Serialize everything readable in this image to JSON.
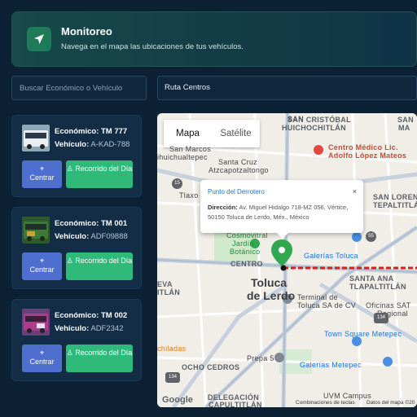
{
  "header": {
    "title": "Monitoreo",
    "subtitle": "Navega en el mapa las ubicaciones de tus vehículos.",
    "icon": "navigation-arrow-icon"
  },
  "search": {
    "placeholder": "Buscar Económico o Vehículo",
    "value": ""
  },
  "route_select": {
    "value": "Ruta Centros"
  },
  "vehicles": [
    {
      "eco_label": "Económico: TM 777",
      "veh_prefix": "Vehículo:",
      "veh_value": "A-KAD-788",
      "center_label": "Centrar",
      "route_label": "Recorrido del Día",
      "thumb_color": "#e8eef2"
    },
    {
      "eco_label": "Económico: TM 001",
      "veh_prefix": "Vehículo:",
      "veh_value": "ADF09888",
      "center_label": "Centrar",
      "route_label": "Recorrido del Día",
      "thumb_color": "#3d7a3a"
    },
    {
      "eco_label": "Económico: TM 002",
      "veh_prefix": "Vehículo:",
      "veh_value": "ADF2342",
      "center_label": "Centrar",
      "route_label": "Recorrido del Día",
      "thumb_color": "#b03a8c"
    }
  ],
  "map": {
    "tabs": [
      "Mapa",
      "Satélite"
    ],
    "active_tab": "Mapa",
    "labels": {
      "san_cristobal": "SAN CRISTÓBAL",
      "huichochitlan": "HUICHOCHITLÁN",
      "san_marcos": "San Marcos",
      "yichualtepec": "ihuichualtepec",
      "santa_cruz": "Santa Cruz",
      "atzcapotzaltongo": "Atzcapotzaltongo",
      "tlaxo": "Tlaxo",
      "san_lorenzo": "SAN LORENZO",
      "tepaltitlan": "TEPALTITLÁN",
      "cosmovitral": "Cosmovitral",
      "jardin": "Jardín",
      "botanico": "Botánico",
      "centro": "CENTRO",
      "toluca": "Toluca",
      "de_lerdo": "de Lerdo",
      "nueva": "EVA",
      "titlan": "ITLÁN",
      "galerias_toluca": "Galerías Toluca",
      "santa_ana": "SANTA ANA",
      "tlapaltitlan": "TLAPALTITLÁN",
      "terminal": "Terminal de",
      "terminal2": "Toluca SA de CV",
      "oficinas": "Oficinas SAT",
      "regional": "Regional",
      "town_square": "Town Square Metepec",
      "chiladas": "chiladas",
      "prepa5": "Prepa 5",
      "galerias_metepec": "Galerías Metepec",
      "ocho_cedros": "OCHO CEDROS",
      "uvm": "UVM Campus",
      "delegacion": "DELEGACIÓN",
      "capultitlan": "CAPULTITLÁN",
      "centro_medico": "Centro Médico Lic.",
      "centro_medico2": "Adolfo López Mateos",
      "san": "SAN",
      "ma": "MA",
      "road_15": "15",
      "road_55": "55",
      "road_134": "134",
      "road_134b": "134"
    },
    "popup": {
      "title": "Punto del Derrotero",
      "close": "×",
      "address_label": "Dirección:",
      "address_value": "Av. Miguel Hidalgo 718-MZ 056, Vértice, 50150 Toluca de Lerdo, Méx., México"
    },
    "footer": {
      "google": "Google",
      "shortcuts": "Combinaciones de teclas",
      "data": "Datos del mapa ©20"
    },
    "colors": {
      "marker": "#2fa84f",
      "route_line": "#d42020"
    }
  }
}
